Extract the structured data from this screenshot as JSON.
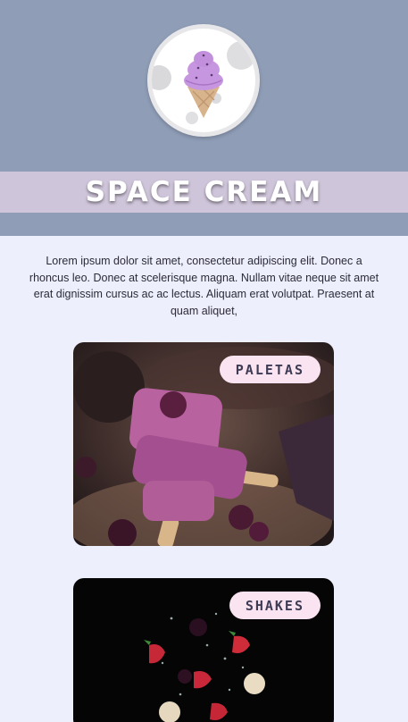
{
  "header": {
    "logo_icon": "ice-cream-cone-icon",
    "title": "SPACE CREAM",
    "background": "#8f9db7",
    "banner_color": "#cfc5da"
  },
  "intro": {
    "text": "Lorem ipsum dolor sit amet, consectetur adipiscing elit. Donec a rhoncus leo. Donec at scelerisque magna. Nullam vitae neque sit amet erat dignissim cursus ac ac lectus. Aliquam erat volutpat. Praesent at quam aliquet,"
  },
  "cards": [
    {
      "label": "PALETAS",
      "image": "purple-popsicles-photo"
    },
    {
      "label": "SHAKES",
      "image": "floating-berries-photo"
    }
  ],
  "colors": {
    "page_bg": "#eeeffd",
    "pill_bg": "#fbe4f2",
    "pill_text": "#3e3b55"
  }
}
